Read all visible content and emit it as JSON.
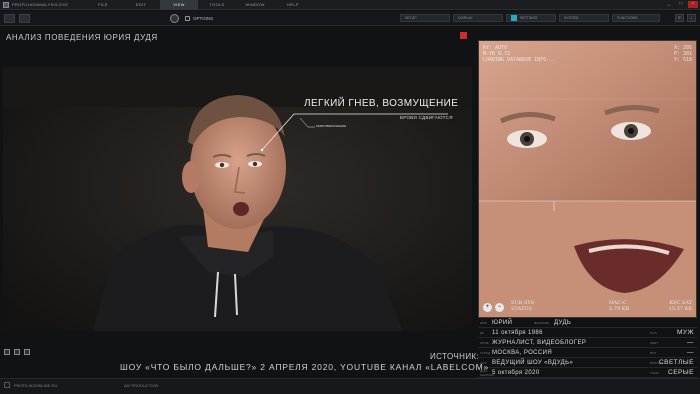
{
  "window": {
    "title": "PROFILINGANALYSIS.EXE",
    "menu": [
      {
        "label": "FILE",
        "active": false
      },
      {
        "label": "EDIT",
        "active": false
      },
      {
        "label": "VIEW",
        "active": true
      },
      {
        "label": "TOOLS",
        "active": false
      },
      {
        "label": "WINDOW",
        "active": false
      },
      {
        "label": "HELP",
        "active": false
      }
    ],
    "controls": {
      "minimize": "_",
      "maximize": "□",
      "close": "×"
    }
  },
  "toolbar": {
    "options_label": "OPTIONS",
    "tabs": [
      {
        "label": "SETUP",
        "active": false
      },
      {
        "label": "DISPLAY",
        "active": false
      },
      {
        "label": "SETTINGS",
        "active": true
      },
      {
        "label": "SYSTEM",
        "active": false
      },
      {
        "label": "FUNCTIONS",
        "active": false
      }
    ]
  },
  "main": {
    "title": "АНАЛИЗ ПОВЕДЕНИЯ ЮРИЯ ДУДЯ",
    "annotation": {
      "emotion": "ЛЕГКИЙ ГНЕВ, ВОЗМУЩЕНИЕ",
      "sub": "БРОВИ СДВИГАЮТСЯ",
      "micro": "МИКРОВЫРАЖЕНИЕ"
    }
  },
  "closeup": {
    "hud_top_left": [
      "RY: AUTO",
      "M-YR 0.72",
      "LOADING DATABASE INFO..."
    ],
    "hud_top_right": [
      "X: 205",
      "P: 301",
      "Y: 518"
    ],
    "sub_sys": "SUB SYS",
    "status": "STATUS",
    "hac_c": "HAC-C",
    "hac_c_size": "5.79 KB",
    "ksc_sat": "KSC SAT",
    "ksc_sat_size": "15.37 KB"
  },
  "info": {
    "rows": [
      {
        "l1": "ИМЯ",
        "v1": "ЮРИЙ",
        "l2": "ФАМИЛИЯ",
        "v2": "ДУДЬ",
        "rl": "",
        "rv": ""
      },
      {
        "l1": "ДР",
        "v1": "11 октября 1986",
        "l2": "",
        "v2": "",
        "rl": "ПОЛ",
        "rv": "МУЖ"
      },
      {
        "l1": "ПРОФ",
        "v1": "ЖУРНАЛИСТ, ВИДЕОБЛОГЕР",
        "l2": "",
        "v2": "",
        "rl": "ЦВЕТ",
        "rv": "—"
      },
      {
        "l1": "ГОРОД",
        "v1": "МОСКВА, РОССИЯ",
        "l2": "",
        "v2": "",
        "rl": "ВОЛ",
        "rv": "—"
      },
      {
        "l1": "ШОУ",
        "v1": "ВЕДУЩИЙ ШОУ «ВДУДЬ»",
        "l2": "",
        "v2": "",
        "rl": "ВОЛОСЫ",
        "rv": "СВЕТЛЫЕ"
      },
      {
        "l1": "ДАТА АНАЛИЗА",
        "v1": "5 октября 2020",
        "l2": "",
        "v2": "",
        "rl": "ГЛАЗА",
        "rv": "СЕРЫЕ"
      }
    ]
  },
  "footer": {
    "source_label": "ИСТОЧНИК:",
    "source": "ШОУ «ЧТО БЫЛО ДАЛЬШЕ?» 2 АПРЕЛЯ 2020, YOUTUBE КАНАЛ «LABELCOM»",
    "status_left": "PROFILINGONLINE.RU",
    "status_mid": "AIV PRODUCTION"
  },
  "colors": {
    "accent": "#2aa6c8",
    "record": "#d12a2a"
  }
}
